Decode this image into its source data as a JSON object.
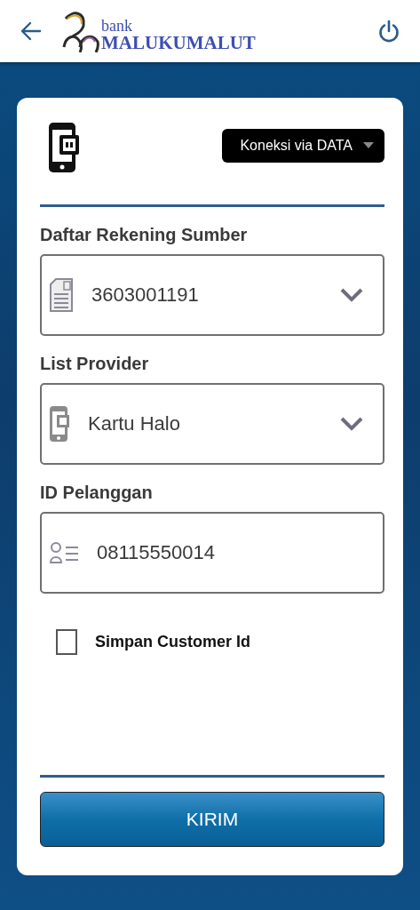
{
  "header": {
    "logo_small": "bank",
    "logo_large": "MALUKUMALUT"
  },
  "connection": {
    "label": "Koneksi via DATA"
  },
  "fields": [
    {
      "kind": "select",
      "label": "Daftar Rekening Sumber",
      "value": "3603001191"
    },
    {
      "kind": "select",
      "label": "List Provider",
      "value": "Kartu Halo"
    },
    {
      "kind": "input",
      "label": "ID Pelanggan",
      "value": "08115550014"
    }
  ],
  "save_option": {
    "label": "Simpan Customer Id",
    "checked": false
  },
  "submit": "KIRIM"
}
